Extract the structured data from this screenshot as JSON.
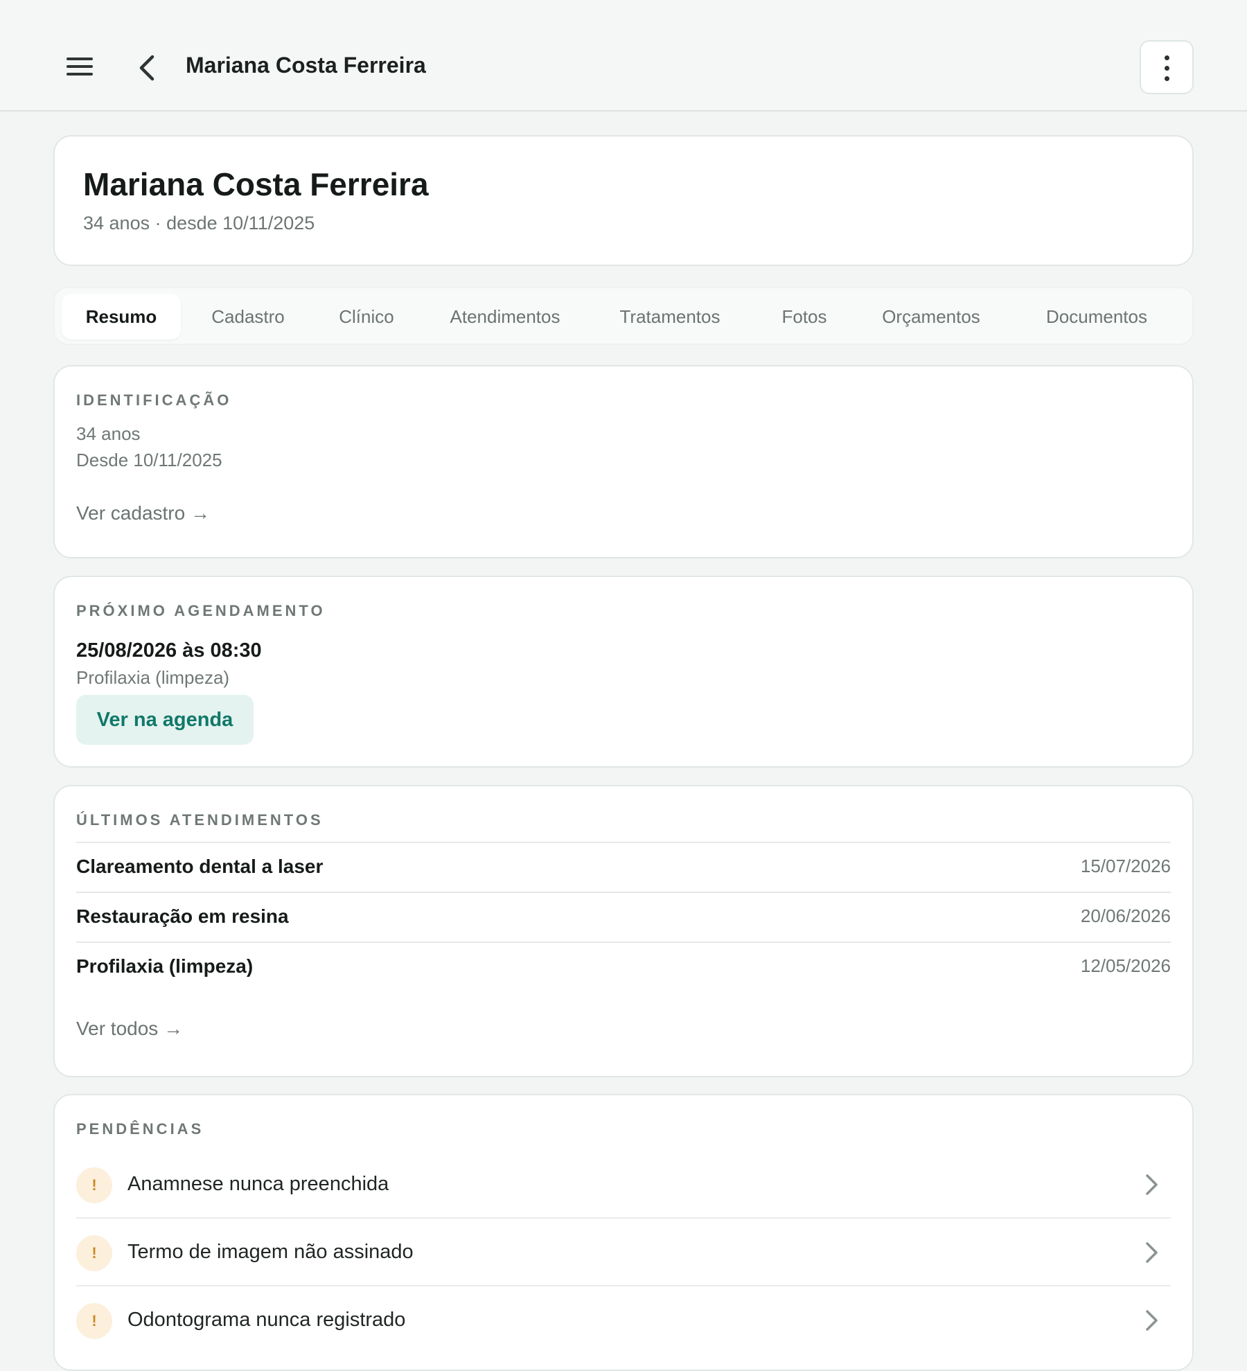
{
  "topbar": {
    "title": "Mariana Costa Ferreira"
  },
  "patient": {
    "name": "Mariana Costa Ferreira",
    "subtitle": "34 anos · desde 10/11/2025"
  },
  "tabs": [
    {
      "label": "Resumo",
      "active": true
    },
    {
      "label": "Cadastro"
    },
    {
      "label": "Clínico"
    },
    {
      "label": "Atendimentos"
    },
    {
      "label": "Tratamentos"
    },
    {
      "label": "Fotos"
    },
    {
      "label": "Orçamentos"
    },
    {
      "label": "Documentos"
    }
  ],
  "identification": {
    "label": "IDENTIFICAÇÃO",
    "age": "34 anos",
    "since": "Desde 10/11/2025",
    "link": "Ver cadastro →"
  },
  "next_appointment": {
    "label": "PRÓXIMO AGENDAMENTO",
    "datetime": "25/08/2026 às 08:30",
    "procedure": "Profilaxia (limpeza)",
    "button": "Ver na agenda"
  },
  "recent_visits": {
    "label": "ÚLTIMOS ATENDIMENTOS",
    "items": [
      {
        "name": "Clareamento dental a laser",
        "date": "15/07/2026"
      },
      {
        "name": "Restauração em resina",
        "date": "20/06/2026"
      },
      {
        "name": "Profilaxia (limpeza)",
        "date": "12/05/2026"
      }
    ],
    "link": "Ver todos →"
  },
  "pending": {
    "label": "PENDÊNCIAS",
    "badge": "!",
    "items": [
      {
        "text": "Anamnese nunca preenchida"
      },
      {
        "text": "Termo de imagem não assinado"
      },
      {
        "text": "Odontograma nunca registrado"
      }
    ]
  },
  "colors": {
    "accent": "#11786a",
    "accent_bg": "#e4f3ef",
    "warning": "#c98a24",
    "warning_bg": "#fcefdc"
  },
  "icons": [
    "menu-icon",
    "chevron-left-icon",
    "more-vertical-icon",
    "chevron-right-icon"
  ]
}
